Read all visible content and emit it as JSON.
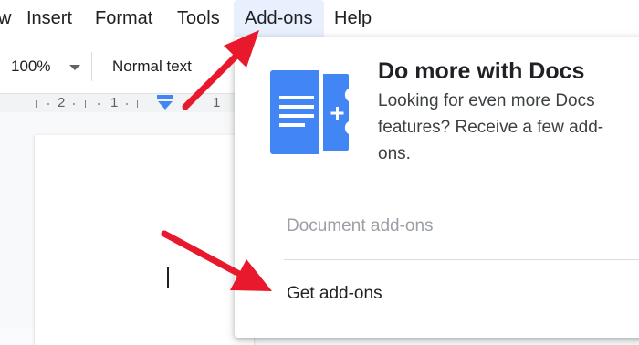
{
  "menubar": {
    "items": [
      {
        "label": "w"
      },
      {
        "label": "Insert"
      },
      {
        "label": "Format"
      },
      {
        "label": "Tools"
      },
      {
        "label": "Add-ons"
      },
      {
        "label": "Help"
      }
    ]
  },
  "toolbar": {
    "zoom": "100%",
    "paragraph_style": "Normal text"
  },
  "ruler": {
    "labels": [
      "2",
      "1",
      "1"
    ]
  },
  "dropdown": {
    "promo_title": "Do more with Docs",
    "promo_description": "Looking for even more Docs features? Receive a few add-ons.",
    "items": [
      {
        "label": "Document add-ons",
        "enabled": false
      },
      {
        "label": "Get add-ons",
        "enabled": true
      }
    ]
  },
  "colors": {
    "accent": "#4285f4",
    "annotation_arrow": "#e8192c",
    "active_menu_bg": "#e8f0fe"
  },
  "icons": [
    "chevron-down-icon",
    "indent-marker-icon",
    "add-ons-puzzle-icon",
    "annotation-arrow"
  ]
}
